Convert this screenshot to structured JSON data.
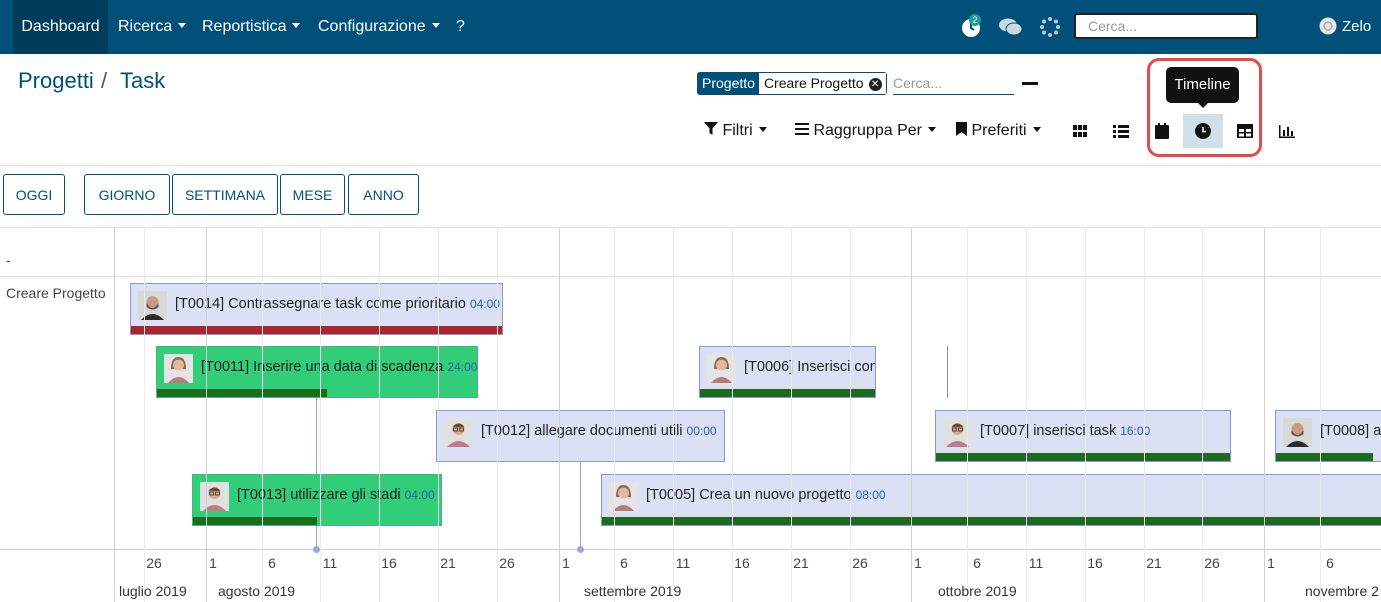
{
  "navbar": {
    "items": [
      {
        "label": "Dashboard",
        "dropdown": false
      },
      {
        "label": "Ricerca",
        "dropdown": true
      },
      {
        "label": "Reportistica",
        "dropdown": true
      },
      {
        "label": "Configurazione",
        "dropdown": true
      },
      {
        "label": "?",
        "dropdown": false
      }
    ],
    "activity_count": "2",
    "search_placeholder": "Cerca...",
    "user_name": "Zelo",
    "bg_color": "#00507a"
  },
  "breadcrumb": {
    "parent": "Progetti",
    "separator": "/",
    "current": "Task"
  },
  "search": {
    "facet_label": "Progetto",
    "facet_value": "Creare Progetto",
    "placeholder": "Cerca..."
  },
  "controls": {
    "filters": "Filtri",
    "group_by": "Raggruppa Per",
    "favorites": "Preferiti"
  },
  "views": [
    {
      "icon": "kanban-icon",
      "active": false
    },
    {
      "icon": "list-icon",
      "active": false
    },
    {
      "icon": "calendar-icon",
      "active": false
    },
    {
      "icon": "clock-icon",
      "active": true
    },
    {
      "icon": "pivot-icon",
      "active": false
    },
    {
      "icon": "graph-icon",
      "active": false
    }
  ],
  "tooltip": "Timeline",
  "scale_buttons": {
    "today": "OGGI",
    "day": "GIORNO",
    "week": "SETTIMANA",
    "month": "MESE",
    "year": "ANNO"
  },
  "timeline": {
    "header_label": "-",
    "group": "Creare Progetto",
    "day_ticks": [
      "26",
      "1",
      "6",
      "11",
      "16",
      "21",
      "26",
      "1",
      "6",
      "11",
      "16",
      "21",
      "26",
      "1",
      "6",
      "11",
      "16",
      "21",
      "26",
      "1",
      "6"
    ],
    "months": [
      "luglio 2019",
      "agosto 2019",
      "settembre 2019",
      "ottobre 2019",
      "novembre 2"
    ],
    "tasks": [
      {
        "code": "[T0014]",
        "name": "Contrassegnare task come prioritario",
        "time": "04:00",
        "style": "blue",
        "progress": 1.0,
        "bar_color": "red",
        "avatar": "man-beard"
      },
      {
        "code": "[T0011]",
        "name": "Inserire una data di scadenza",
        "time": "24:00",
        "style": "green",
        "progress": 0.53,
        "bar_color": "darkgreen",
        "avatar": "woman"
      },
      {
        "code": "[T0006]",
        "name": "Inserisci cont",
        "time": "",
        "style": "blue",
        "progress": 1.0,
        "bar_color": "darkgreen",
        "avatar": "woman"
      },
      {
        "code": "[T0012]",
        "name": "allegare documenti utili",
        "time": "00:00",
        "style": "blue",
        "progress": 0.0,
        "bar_color": "darkgreen",
        "avatar": "man-glasses"
      },
      {
        "code": "[T0007]",
        "name": "inserisci task",
        "time": "16:00",
        "style": "blue",
        "progress": 1.0,
        "bar_color": "darkgreen",
        "avatar": "man-glasses"
      },
      {
        "code": "[T0008]",
        "name": "as",
        "time": "",
        "style": "blue",
        "progress": 0.92,
        "bar_color": "darkgreen",
        "avatar": "man-beard"
      },
      {
        "code": "[T0013]",
        "name": "utilizzare gli stadi",
        "time": "04:00",
        "style": "green",
        "progress": 0.5,
        "bar_color": "darkgreen",
        "avatar": "man-glasses"
      },
      {
        "code": "[T0005]",
        "name": "Crea un nuovo progetto",
        "time": "08:00",
        "style": "blue",
        "progress": 1.0,
        "bar_color": "darkgreen",
        "avatar": "woman"
      }
    ]
  }
}
